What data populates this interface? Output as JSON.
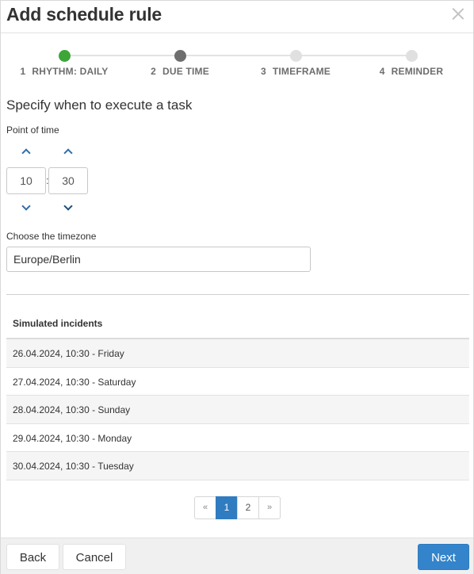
{
  "dialog": {
    "title": "Add schedule rule"
  },
  "stepper": {
    "steps": [
      {
        "num": "1",
        "label": "RHYTHM: DAILY",
        "state": "done"
      },
      {
        "num": "2",
        "label": "DUE TIME",
        "state": "active"
      },
      {
        "num": "3",
        "label": "TIMEFRAME",
        "state": "pending"
      },
      {
        "num": "4",
        "label": "REMINDER",
        "state": "pending"
      }
    ]
  },
  "form": {
    "section_title": "Specify when to execute a task",
    "point_of_time_label": "Point of time",
    "hour": "10",
    "separator": ":",
    "minute": "30",
    "timezone_label": "Choose the timezone",
    "timezone": "Europe/Berlin"
  },
  "incidents": {
    "header": "Simulated incidents",
    "rows": [
      "26.04.2024, 10:30 - Friday",
      "27.04.2024, 10:30 - Saturday",
      "28.04.2024, 10:30 - Sunday",
      "29.04.2024, 10:30 - Monday",
      "30.04.2024, 10:30 - Tuesday"
    ]
  },
  "pagination": {
    "prev": "«",
    "pages": [
      "1",
      "2"
    ],
    "next": "»",
    "current": "1"
  },
  "footer": {
    "back": "Back",
    "cancel": "Cancel",
    "next": "Next"
  },
  "colors": {
    "step_done": "#3ea639",
    "step_active": "#6e6e6e",
    "primary": "#3384ca",
    "chevron": "#2f6ea8"
  },
  "icons": {
    "close": "close-icon",
    "up": "chevron-up-icon",
    "down": "chevron-down-icon"
  }
}
